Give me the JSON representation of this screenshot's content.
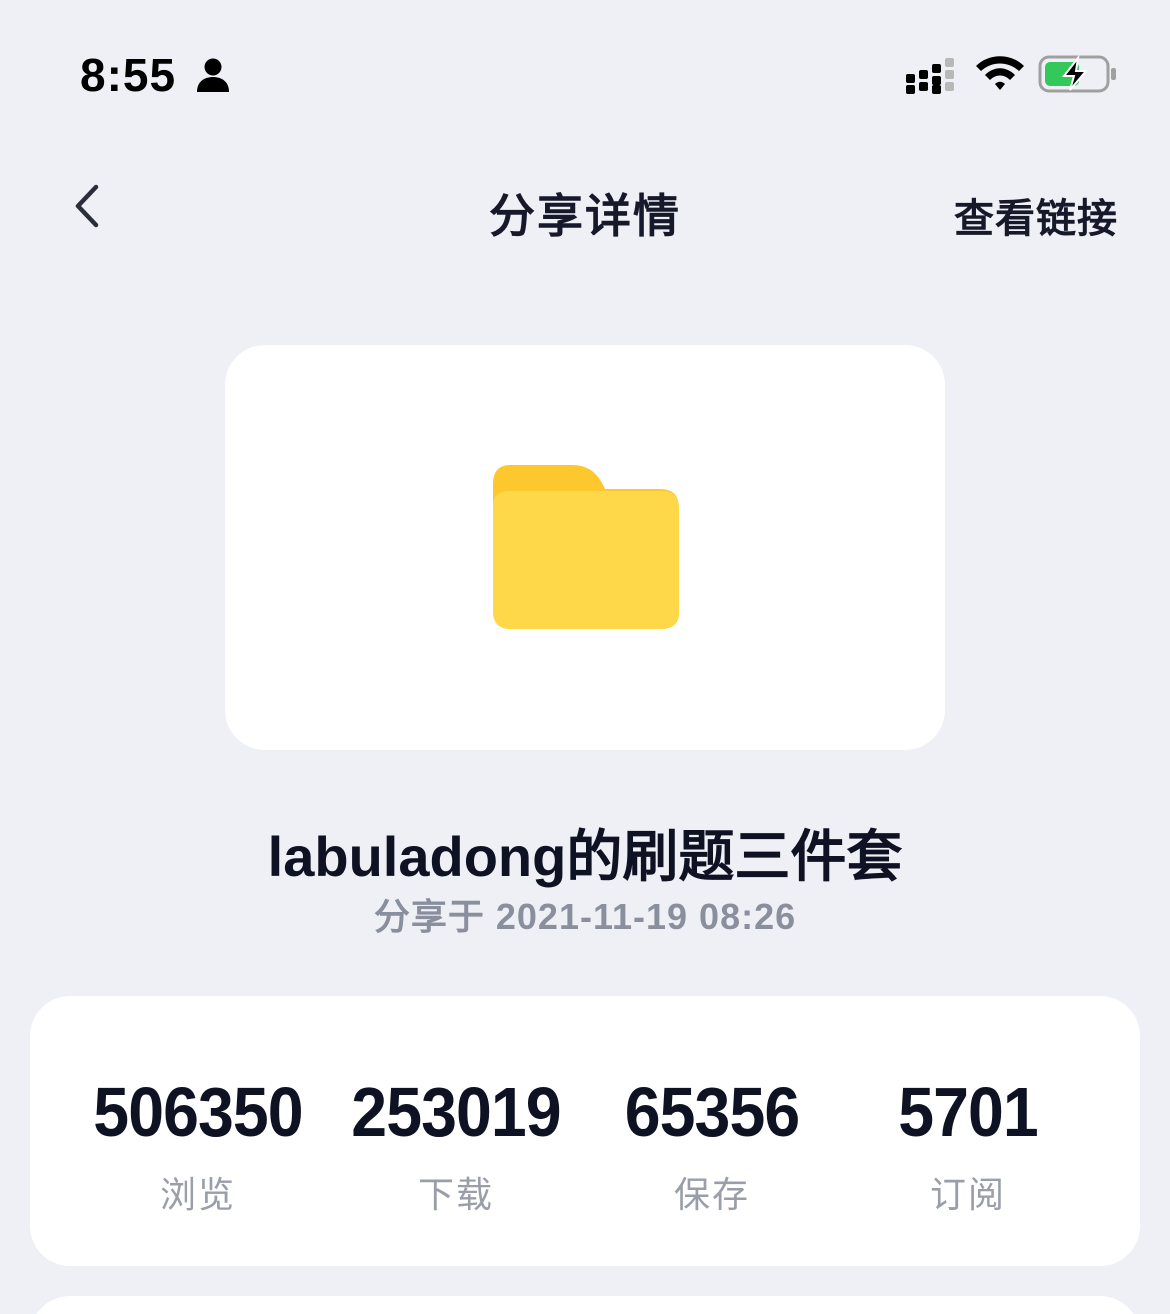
{
  "status_bar": {
    "time": "8:55",
    "battery_color": "#34c759"
  },
  "nav": {
    "title": "分享详情",
    "view_link_label": "查看链接"
  },
  "file": {
    "name": "labuladong的刷题三件套",
    "share_time": "分享于 2021-11-19 08:26",
    "icon": "folder-icon",
    "icon_color": "#ffd84a"
  },
  "stats": [
    {
      "value": "506350",
      "label": "浏览"
    },
    {
      "value": "253019",
      "label": "下载"
    },
    {
      "value": "65356",
      "label": "保存"
    },
    {
      "value": "5701",
      "label": "订阅"
    }
  ]
}
